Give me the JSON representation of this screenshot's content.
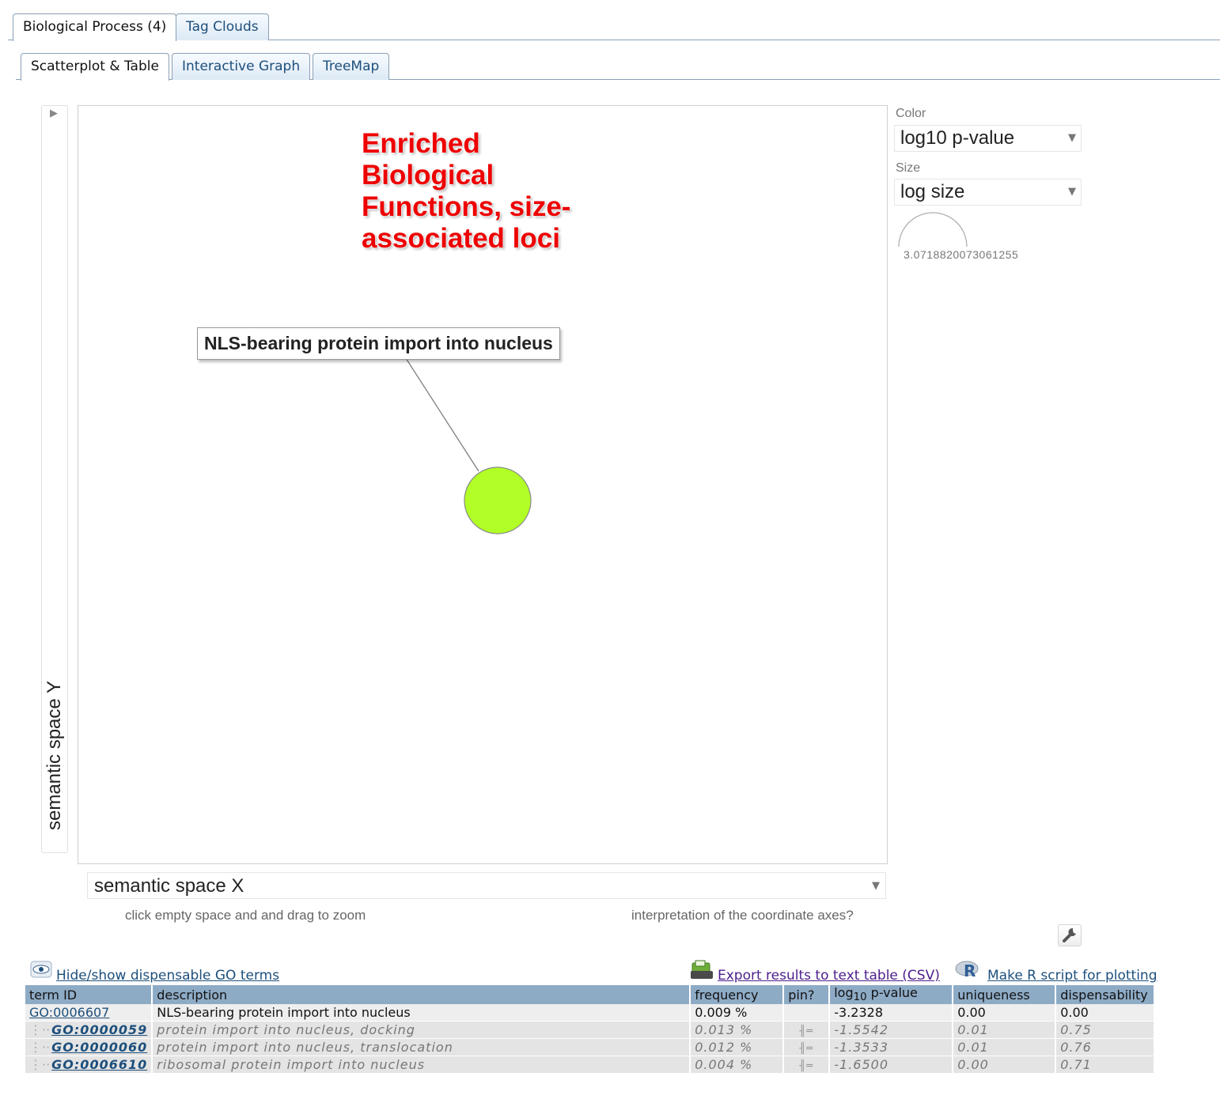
{
  "tabs_top": [
    {
      "label": "Biological Process (4)",
      "active": true
    },
    {
      "label": "Tag Clouds",
      "active": false
    }
  ],
  "tabs_sub": [
    {
      "label": "Scatterplot & Table",
      "active": true
    },
    {
      "label": "Interactive Graph",
      "active": false
    },
    {
      "label": "TreeMap",
      "active": false
    }
  ],
  "plot": {
    "annotation_lines": [
      "Enriched",
      "Biological",
      "Functions, size-",
      "associated loci"
    ],
    "callout_label": "NLS-bearing protein import into nucleus",
    "y_axis_label": "semantic space Y",
    "x_axis_select": "semantic space X",
    "hint_zoom": "click empty space and and drag to zoom",
    "hint_axes": "interpretation of the coordinate axes?",
    "point_color": "#b1ff26"
  },
  "controls": {
    "color_label": "Color",
    "color_value": "log10 p-value",
    "size_label": "Size",
    "size_value": "log size",
    "size_legend_value": "3.0718820073061255"
  },
  "links": {
    "hide_show": "Hide/show dispensable GO terms",
    "export_csv": "Export results to text table (CSV)",
    "r_script": "Make R script for plotting"
  },
  "table": {
    "headers": [
      "term ID",
      "description",
      "frequency",
      "pin?",
      "log",
      "10",
      " p-value",
      "uniqueness",
      "dispensability"
    ],
    "rows": [
      {
        "term_id": "GO:0006607",
        "description": "NLS-bearing protein import into nucleus",
        "frequency": "0.009 %",
        "log10_pvalue": "-3.2328",
        "uniqueness": "0.00",
        "dispensability": "0.00"
      },
      {
        "term_id": "GO:0000059",
        "description": "protein import into nucleus, docking",
        "frequency": "0.013 %",
        "log10_pvalue": "-1.5542",
        "uniqueness": "0.01",
        "dispensability": "0.75"
      },
      {
        "term_id": "GO:0000060",
        "description": "protein import into nucleus, translocation",
        "frequency": "0.012 %",
        "log10_pvalue": "-1.3533",
        "uniqueness": "0.01",
        "dispensability": "0.76"
      },
      {
        "term_id": "GO:0006610",
        "description": "ribosomal protein import into nucleus",
        "frequency": "0.004 %",
        "log10_pvalue": "-1.6500",
        "uniqueness": "0.00",
        "dispensability": "0.71"
      }
    ]
  }
}
